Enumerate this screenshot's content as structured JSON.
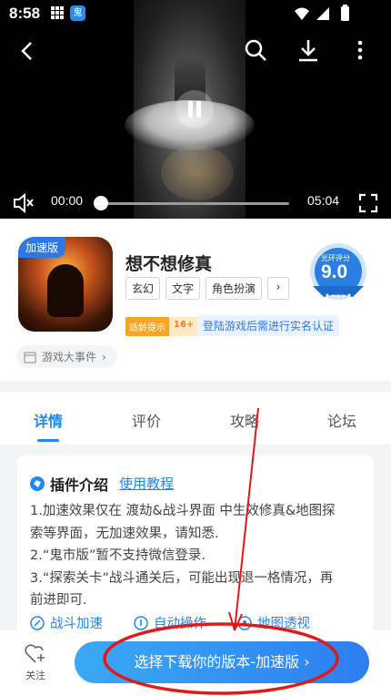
{
  "status_bar": {
    "time": "8:58",
    "app_icon_text": "鬼"
  },
  "video": {
    "current_time": "00:00",
    "duration": "05:04",
    "progress": 0.0
  },
  "app": {
    "icon_tag": "加速版",
    "title": "想不想修真",
    "tags": [
      "玄幻",
      "文字",
      "角色扮演"
    ],
    "age_label": "适龄提示",
    "age_value": "16+",
    "realname_note": "登陆游戏后需进行实名认证",
    "rating_label": "光环评分",
    "rating_value": "9.0",
    "events_label": "游戏大事件"
  },
  "tabs": [
    "详情",
    "评价",
    "攻略",
    "论坛"
  ],
  "plugin": {
    "title": "插件介绍",
    "link": "使用教程",
    "lines": [
      "1.加速效果仅在 渡劫&战斗界面 中生效修真&地图探",
      "索等界面，无加速效果，请知悉.",
      "2.“鬼市版”暂不支持微信登录.",
      "3.“探索关卡”战斗通关后，可能出现退一格情况，再",
      "前进即可."
    ],
    "features": [
      "战斗加速",
      "自动操作",
      "地图透视"
    ]
  },
  "bottom_bar": {
    "follow_label": "关注",
    "download_label": "选择下载你的版本-加速版 ›"
  },
  "colors": {
    "accent": "#1e88f5",
    "annotation": "#e01919"
  }
}
